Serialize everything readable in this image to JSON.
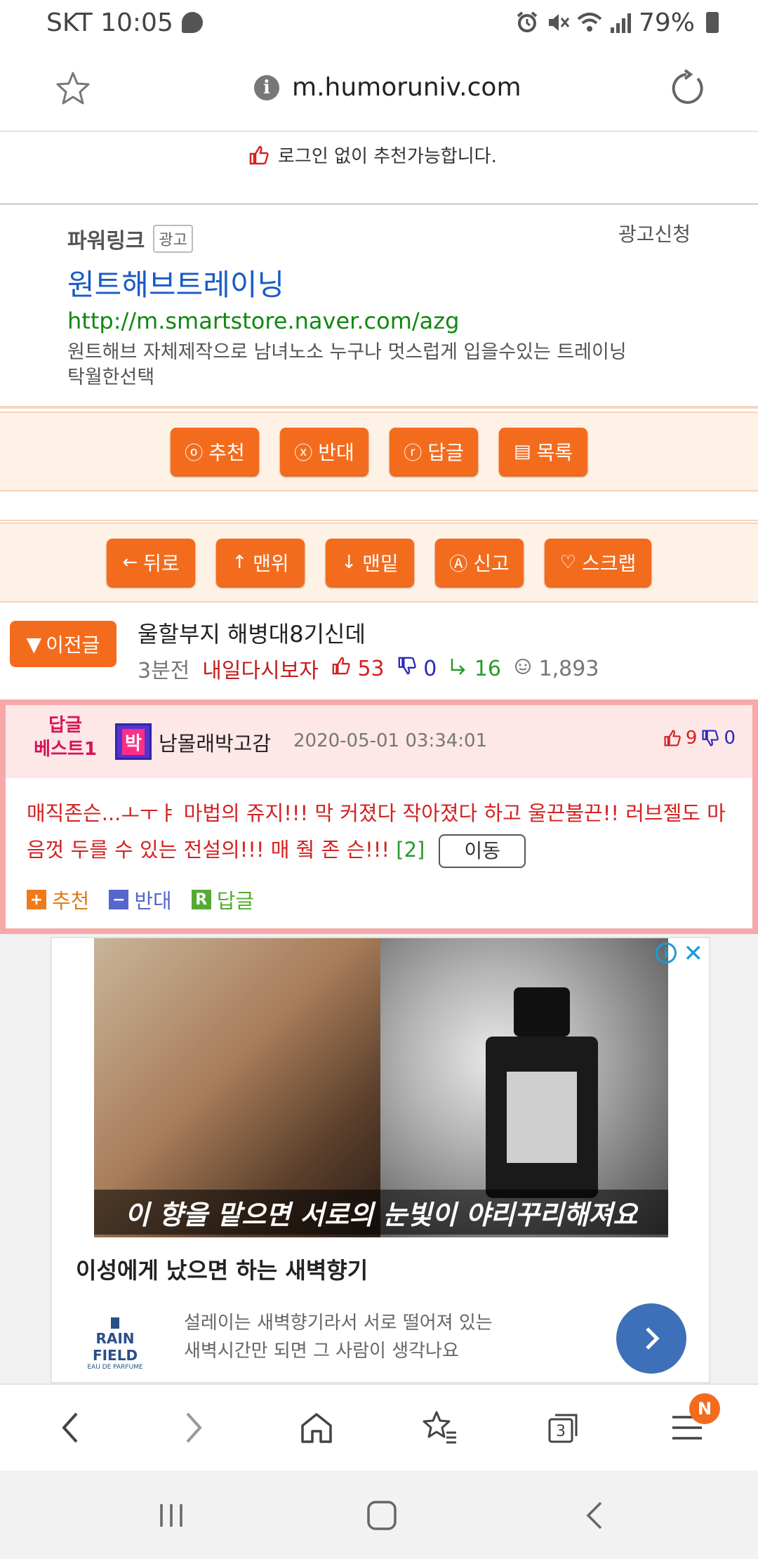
{
  "status_bar": {
    "carrier_time": "SKT 10:05",
    "battery": "79%"
  },
  "url_bar": {
    "url": "m.humoruniv.com"
  },
  "notice": {
    "text": "로그인 없이 추천가능합니다."
  },
  "powerlink": {
    "label": "파워링크",
    "badge": "광고",
    "apply": "광고신청",
    "title": "원트해브트레이닝",
    "url": "http://m.smartstore.naver.com/azg",
    "desc_line1": "원트해브 자체제작으로 남녀노소 누구나 멋스럽게 입을수있는 트레이닝",
    "desc_line2": "탁월한선택"
  },
  "action_bar_1": [
    {
      "icon": "ⓞ",
      "label": "추천"
    },
    {
      "icon": "ⓧ",
      "label": "반대"
    },
    {
      "icon": "ⓡ",
      "label": "답글"
    },
    {
      "icon": "▤",
      "label": "목록"
    }
  ],
  "action_bar_2": [
    {
      "icon": "←",
      "label": "뒤로"
    },
    {
      "icon": "↑",
      "label": "맨위"
    },
    {
      "icon": "↓",
      "label": "맨밑"
    },
    {
      "icon": "Ⓐ",
      "label": "신고"
    },
    {
      "icon": "♡",
      "label": "스크랩"
    }
  ],
  "prev_post": {
    "button": "이전글",
    "title": "울할부지 해병대8기신데",
    "time": "3분전",
    "author": "내일다시보자",
    "up": "53",
    "down": "0",
    "replies": "16",
    "views": "1,893"
  },
  "best_reply": {
    "label_line1": "답글",
    "label_line2": "베스트1",
    "avatar_char": "박",
    "author": "남몰래박고감",
    "date": "2020-05-01 03:34:01",
    "up": "9",
    "down": "0",
    "body": "매직존슨...ㅗㅜㅑ 마법의 쥬지!!! 막 커졌다 작아졌다 하고 울끈불끈!! 러브젤도 마음껏 두를 수 있는 전설의!!! 매 줰 존 슨!!! ",
    "reply_count": "[2]",
    "move_button": "이동",
    "actions": [
      "추천",
      "반대",
      "답글"
    ]
  },
  "ad": {
    "caption": "이 향을 맡으면 서로의 눈빛이 야리꾸리해져요",
    "headline": "이성에게 났으면 하는 새벽향기",
    "desc_line1": "설레이는 새벽향기라서 서로 떨어져 있는",
    "desc_line2": "새벽시간만 되면 그 사람이 생각나요",
    "logo_line1": "RAIN FIELD",
    "logo_line2": "EAU DE PARFUME"
  },
  "browser_nav": {
    "tabs_count": "3",
    "menu_badge": "N"
  },
  "colors": {
    "accent": "#f36c1d",
    "link": "#1a5bc4",
    "url_green": "#118811",
    "best_red": "#d42222"
  }
}
